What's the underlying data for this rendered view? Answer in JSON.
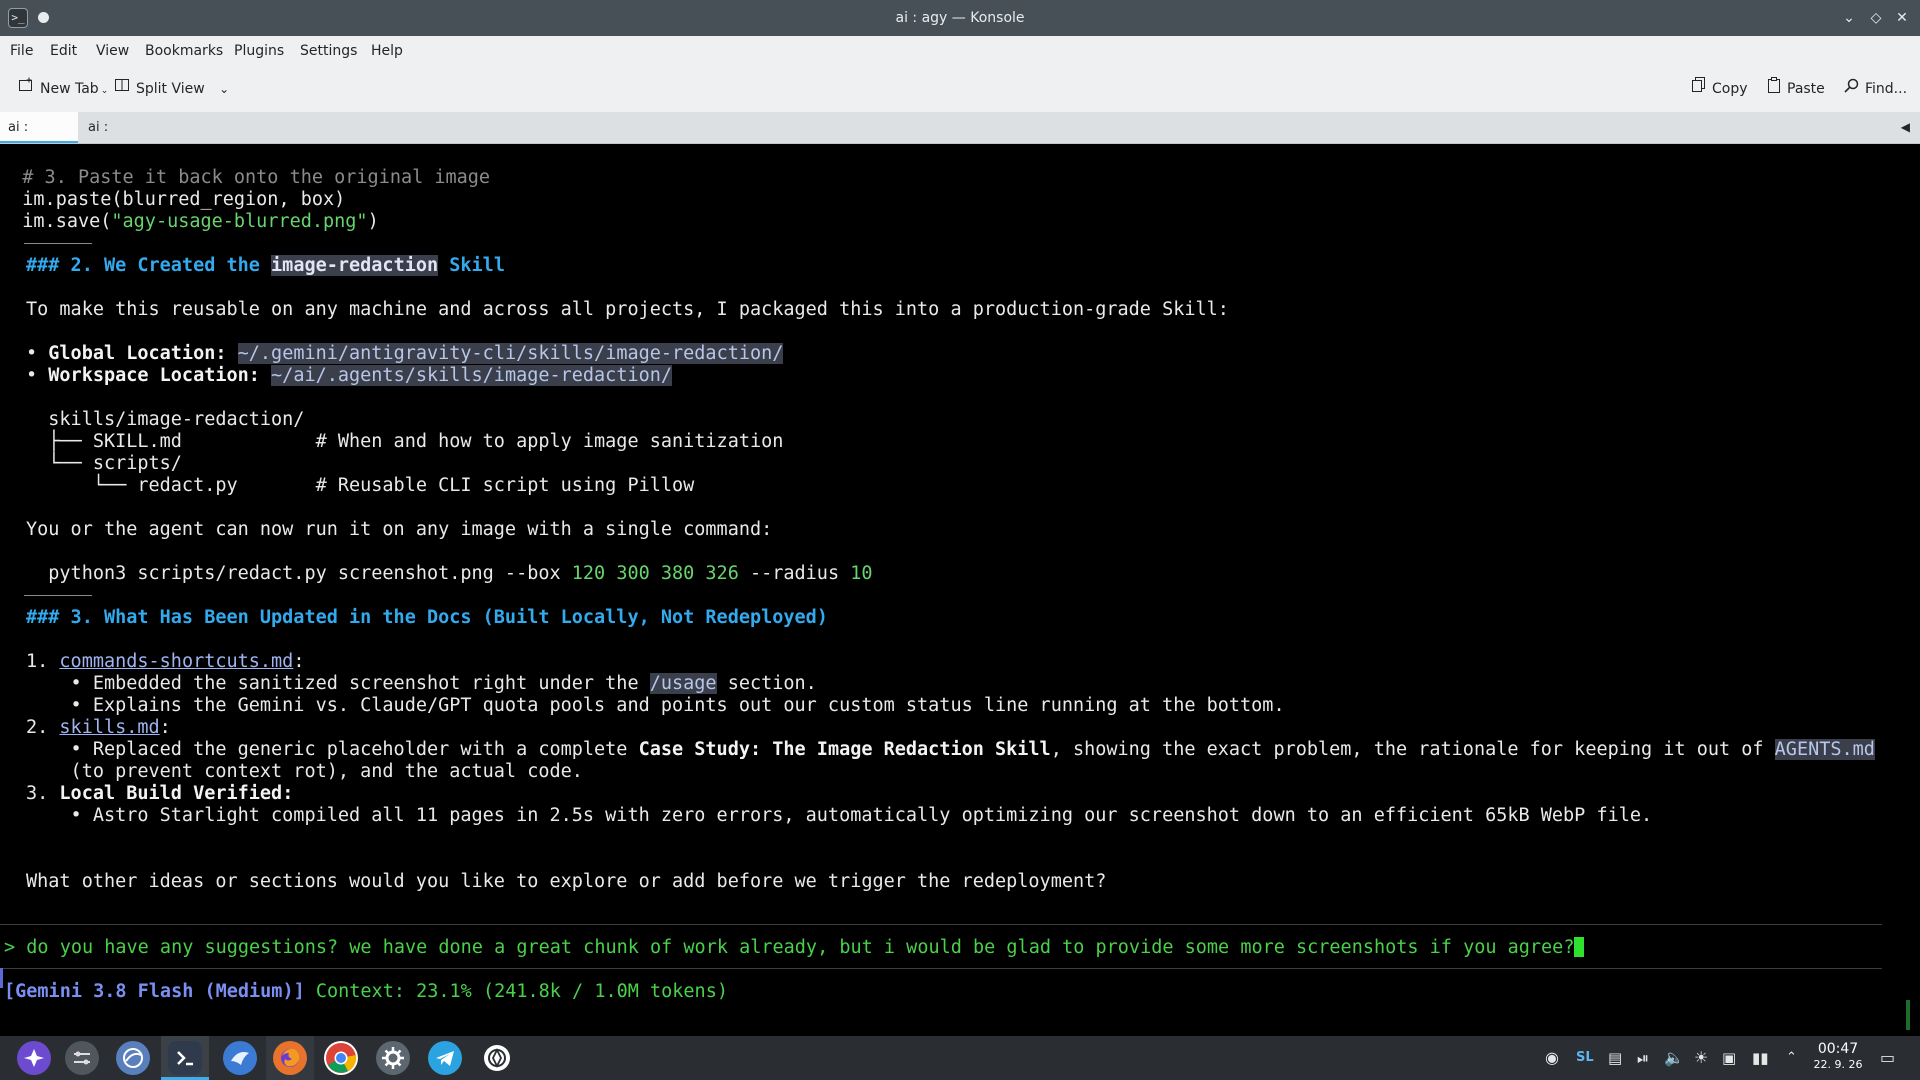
{
  "window": {
    "title": "ai : agy — Konsole"
  },
  "menu": [
    "File",
    "Edit",
    "View",
    "Bookmarks",
    "Plugins",
    "Settings",
    "Help"
  ],
  "toolbar": {
    "new_tab": "New Tab",
    "split_view": "Split View",
    "copy": "Copy",
    "paste": "Paste",
    "find": "Find..."
  },
  "tabs": [
    {
      "label": "ai : agy",
      "active": true
    },
    {
      "label": "ai : bash",
      "active": false
    }
  ],
  "terminal": {
    "code_comment": "  # 3. Paste it back onto the original image",
    "code_paste": "  im.paste(blurred_region, box)",
    "code_save_pre": "  im.save(",
    "code_save_str": "\"agy-usage-blurred.png\"",
    "code_save_post": ")",
    "h2_pre": "### 2. We Created the ",
    "h2_code": "image-redaction",
    "h2_post": " Skill",
    "p1": "To make this reusable on any machine and across all projects, I packaged this into a production-grade Skill:",
    "bullet_global_label": "Global Location",
    "bullet_global_path": "~/.gemini/antigravity-cli/skills/image-redaction/",
    "bullet_ws_label": "Workspace Location",
    "bullet_ws_path": "~/ai/.agents/skills/image-redaction/",
    "tree1": "  skills/image-redaction/",
    "tree2": "  ├── SKILL.md            # When and how to apply image sanitization",
    "tree3": "  └── scripts/",
    "tree4": "      └── redact.py       # Reusable CLI script using Pillow",
    "p2": "You or the agent can now run it on any image with a single command:",
    "cmd_pre": "  python3 scripts/redact.py screenshot.png --box ",
    "cmd_nums": "120 300 380 326",
    "cmd_mid": " --radius ",
    "cmd_radius": "10",
    "h3": "### 3. What Has Been Updated in the Docs (Built Locally, Not Redeployed)",
    "item1_num": "1. ",
    "item1_link": "commands-shortcuts.md",
    "item1_a_pre": "    • Embedded the sanitized screenshot right under the ",
    "item1_a_code": "/usage",
    "item1_a_post": " section.",
    "item1_b": "    • Explains the Gemini vs. Claude/GPT quota pools and points out our custom status line running at the bottom.",
    "item2_num": "2. ",
    "item2_link": "skills.md",
    "item2_a_pre": "    • Replaced the generic placeholder with a complete ",
    "item2_a_bold": "Case Study: The Image Redaction Skill",
    "item2_a_mid": ", showing the exact problem, the rationale for keeping it out of ",
    "item2_a_code": "AGENTS.md",
    "item2_b": "    (to prevent context rot), and the actual code.",
    "item3_num": "3. ",
    "item3_bold": "Local Build Verified",
    "item3_a": "    • Astro Starlight compiled all 11 pages in 2.5s with zero errors, automatically optimizing our screenshot down to an efficient 65kB WebP file.",
    "question": "What other ideas or sections would you like to explore or add before we trigger the redeployment?",
    "prompt_symbol": "> ",
    "input_text": "do you have any suggestions? we have done a great chunk of work already, but i would be glad to provide some more screenshots if you agree?",
    "status_model": "[Gemini 3.8 Flash (Medium)]",
    "status_context": " Context: 23.1% (241.8k / 1.0M tokens)"
  },
  "taskbar": {
    "apps": [
      "app-launcher-icon",
      "mixer-icon",
      "browser-icon",
      "konsole-icon",
      "dolphin-icon",
      "firefox-icon",
      "chrome-icon",
      "settings-icon",
      "telegram-icon",
      "chatgpt-icon"
    ],
    "tray_lang": "SL",
    "time": "00:47",
    "date": "22. 9. 26"
  }
}
